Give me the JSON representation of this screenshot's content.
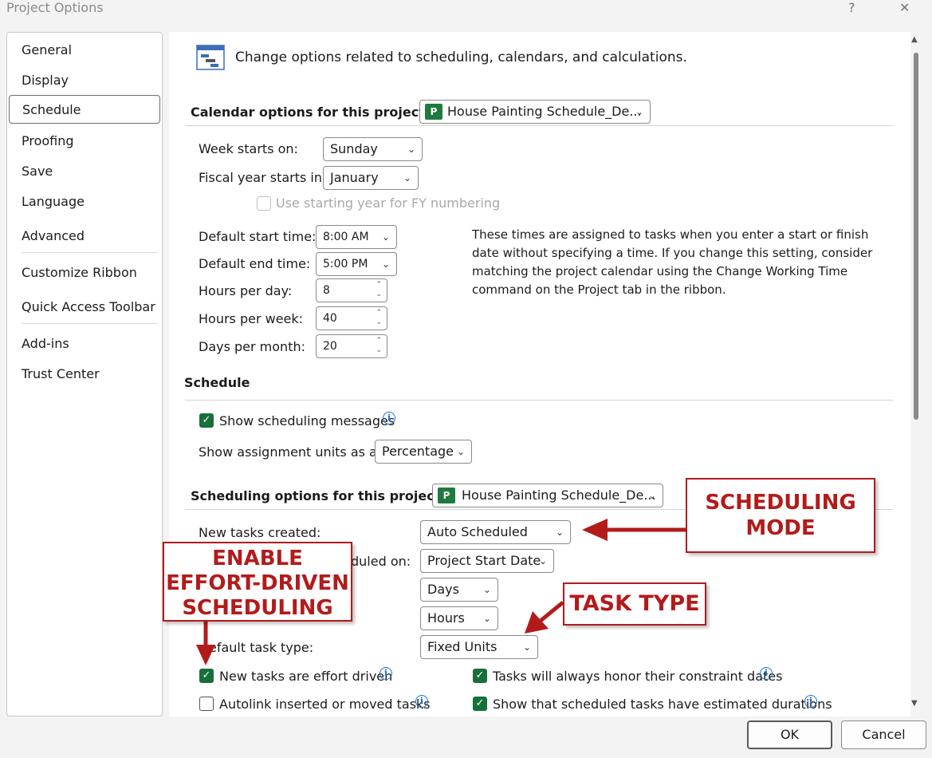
{
  "window": {
    "title": "Project Options",
    "help_label": "?",
    "close_label": "✕"
  },
  "nav": {
    "items": [
      {
        "label": "General"
      },
      {
        "label": "Display"
      },
      {
        "label": "Schedule"
      },
      {
        "label": "Proofing"
      },
      {
        "label": "Save"
      },
      {
        "label": "Language"
      },
      {
        "label": "Advanced"
      },
      {
        "label": "Customize Ribbon"
      },
      {
        "label": "Quick Access Toolbar"
      },
      {
        "label": "Add-ins"
      },
      {
        "label": "Trust Center"
      }
    ],
    "selected": "Schedule"
  },
  "header": {
    "text": "Change options related to scheduling, calendars, and calculations."
  },
  "calendar": {
    "heading": "Calendar options for this project:",
    "project": "House Painting Schedule_De...",
    "week_starts_label": "Week starts on:",
    "week_starts_value": "Sunday",
    "fiscal_label": "Fiscal year starts in:",
    "fiscal_value": "January",
    "fy_numbering_label": "Use starting year for FY numbering",
    "start_time_label": "Default start time:",
    "start_time_value": "8:00 AM",
    "end_time_label": "Default end time:",
    "end_time_value": "5:00 PM",
    "hours_day_label": "Hours per day:",
    "hours_day_value": "8",
    "hours_week_label": "Hours per week:",
    "hours_week_value": "40",
    "days_month_label": "Days per month:",
    "days_month_value": "20",
    "note": "These times are assigned to tasks when you enter a start or finish date without specifying a time. If you change this setting, consider matching the project calendar using the Change Working Time command on the Project tab in the ribbon."
  },
  "schedule": {
    "heading": "Schedule",
    "show_messages_label": "Show scheduling messages",
    "show_messages_checked": true,
    "assignment_units_label": "Show assignment units as a:",
    "assignment_units_value": "Percentage"
  },
  "scheduling_options": {
    "heading": "Scheduling options for this project:",
    "project": "House Painting Schedule_De...",
    "new_tasks_label": "New tasks created:",
    "new_tasks_value": "Auto Scheduled",
    "auto_scheduled_label_fragment": "duled on:",
    "auto_scheduled_value": "Project Start Date",
    "duration_value": "Days",
    "work_value": "Hours",
    "task_type_label": "efault task type:",
    "task_type_value": "Fixed Units",
    "effort_driven_label": "New tasks are effort driven",
    "effort_driven_checked": true,
    "autolink_label": "Autolink inserted or moved tasks",
    "autolink_checked": false,
    "honor_constraints_label": "Tasks will always honor their constraint dates",
    "honor_constraints_checked": true,
    "estimated_durations_label": "Show that scheduled tasks have estimated durations",
    "estimated_durations_checked": true
  },
  "callouts": {
    "scheduling_mode": [
      "SCHEDULING",
      "MODE"
    ],
    "effort_driven": [
      "ENABLE",
      "EFFORT-DRIVEN",
      "SCHEDULING"
    ],
    "task_type": "TASK TYPE",
    "color": "#b31b1b"
  },
  "footer": {
    "ok_label": "OK",
    "cancel_label": "Cancel"
  },
  "colors": {
    "checkbox_accent": "#17703a",
    "info_icon": "#1d6fd1",
    "callout": "#b31b1b"
  }
}
